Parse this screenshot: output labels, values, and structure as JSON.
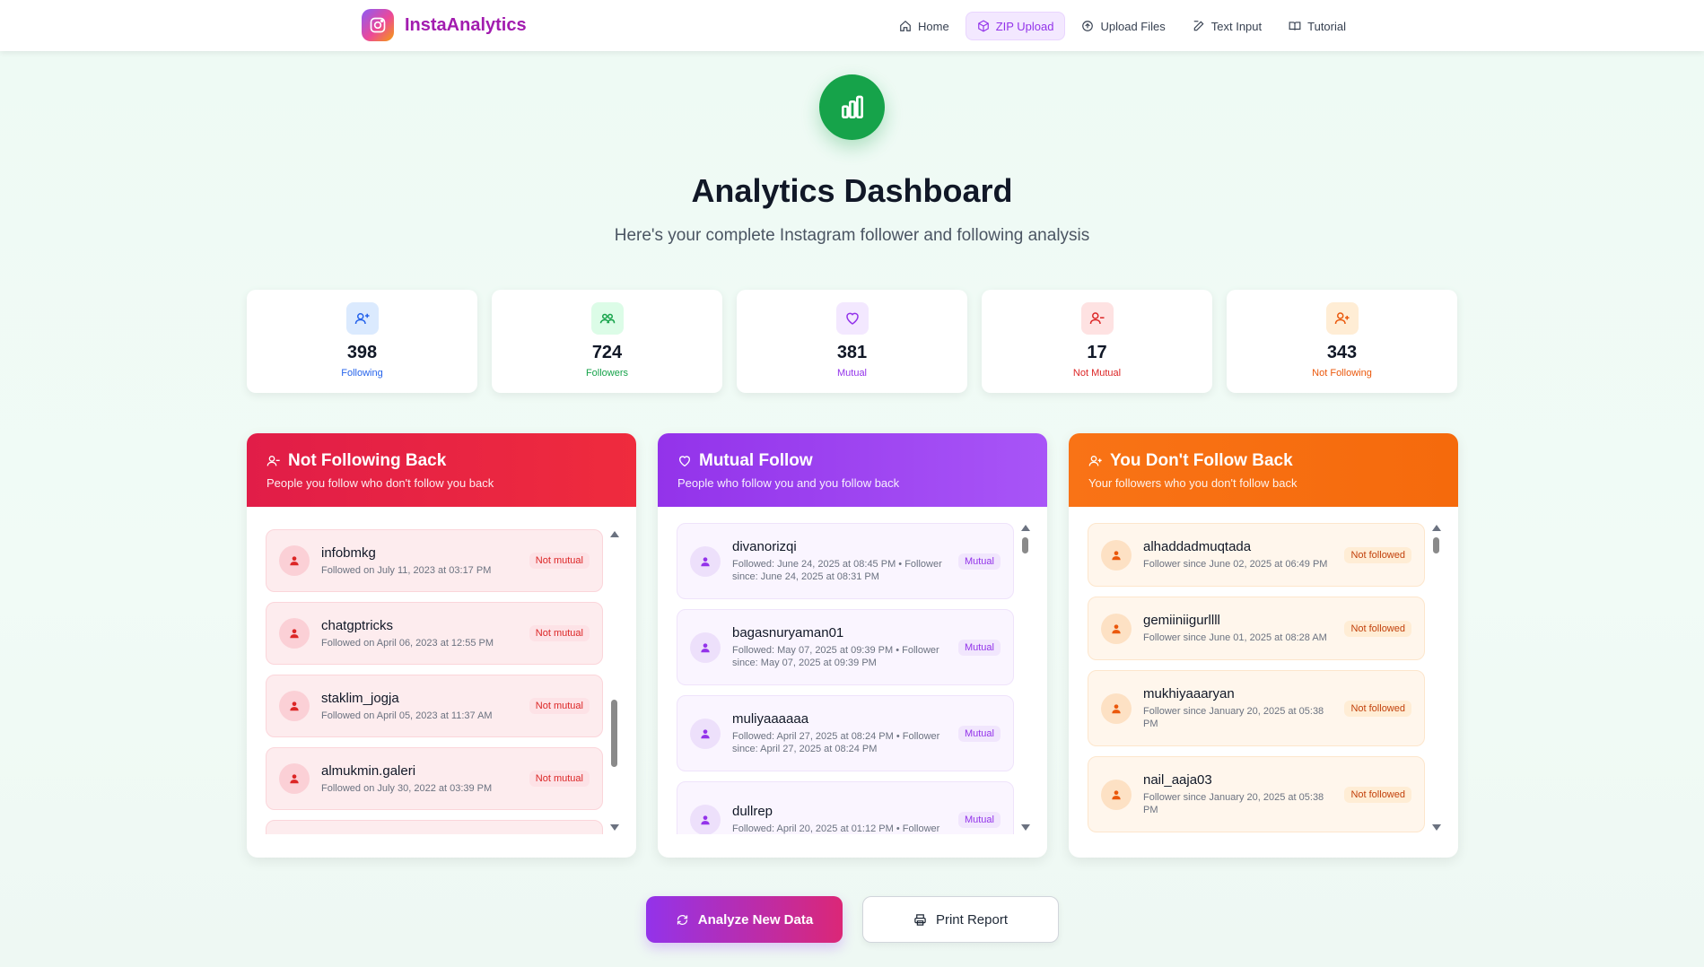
{
  "brand": {
    "name": "InstaAnalytics",
    "icon": "instagram-icon"
  },
  "nav": [
    {
      "label": "Home",
      "icon": "home-icon",
      "active": false
    },
    {
      "label": "ZIP Upload",
      "icon": "package-icon",
      "active": true
    },
    {
      "label": "Upload Files",
      "icon": "upload-icon",
      "active": false
    },
    {
      "label": "Text Input",
      "icon": "edit-icon",
      "active": false
    },
    {
      "label": "Tutorial",
      "icon": "book-icon",
      "active": false
    }
  ],
  "hero": {
    "icon": "bar-chart-icon",
    "title": "Analytics Dashboard",
    "subtitle": "Here's your complete Instagram follower and following analysis"
  },
  "stats": [
    {
      "value": "398",
      "label": "Following",
      "icon": "user-plus-icon",
      "color": "#2563eb",
      "bg": "#dbeafe"
    },
    {
      "value": "724",
      "label": "Followers",
      "icon": "users-icon",
      "color": "#16a34a",
      "bg": "#dcfce7"
    },
    {
      "value": "381",
      "label": "Mutual",
      "icon": "heart-icon",
      "color": "#9333ea",
      "bg": "#f3e8ff"
    },
    {
      "value": "17",
      "label": "Not Mutual",
      "icon": "user-minus-icon",
      "color": "#dc2626",
      "bg": "#fee2e2"
    },
    {
      "value": "343",
      "label": "Not Following",
      "icon": "user-plus-icon",
      "color": "#ea580c",
      "bg": "#ffedd5"
    }
  ],
  "panels": {
    "not_following_back": {
      "title": "Not Following Back",
      "description": "People you follow who don't follow you back",
      "color": "#e11d48",
      "items": [
        {
          "name": "infobmkg",
          "meta": "Followed on July 11, 2023 at 03:17 PM",
          "badge": "Not mutual"
        },
        {
          "name": "chatgptricks",
          "meta": "Followed on April 06, 2023 at 12:55 PM",
          "badge": "Not mutual"
        },
        {
          "name": "staklim_jogja",
          "meta": "Followed on April 05, 2023 at 11:37 AM",
          "badge": "Not mutual"
        },
        {
          "name": "almukmin.galeri",
          "meta": "Followed on July 30, 2022 at 03:39 PM",
          "badge": "Not mutual"
        }
      ]
    },
    "mutual": {
      "title": "Mutual Follow",
      "description": "People who follow you and you follow back",
      "color": "#9333ea",
      "items": [
        {
          "name": "divanorizqi",
          "meta": "Followed: June 24, 2025 at 08:45 PM • Follower since: June 24, 2025 at 08:31 PM",
          "badge": "Mutual"
        },
        {
          "name": "bagasnuryaman01",
          "meta": "Followed: May 07, 2025 at 09:39 PM • Follower since: May 07, 2025 at 09:39 PM",
          "badge": "Mutual"
        },
        {
          "name": "muliyaaaaaa",
          "meta": "Followed: April 27, 2025 at 08:24 PM • Follower since: April 27, 2025 at 08:24 PM",
          "badge": "Mutual"
        },
        {
          "name": "dullrep",
          "meta": "Followed: April 20, 2025 at 01:12 PM • Follower",
          "badge": "Mutual"
        }
      ]
    },
    "you_dont_follow_back": {
      "title": "You Don't Follow Back",
      "description": "Your followers who you don't follow back",
      "color": "#f97316",
      "items": [
        {
          "name": "alhaddadmuqtada",
          "meta": "Follower since June 02, 2025 at 06:49 PM",
          "badge": "Not followed"
        },
        {
          "name": "gemiiniigurllll",
          "meta": "Follower since June 01, 2025 at 08:28 AM",
          "badge": "Not followed"
        },
        {
          "name": "mukhiyaaaryan",
          "meta": "Follower since January 20, 2025 at 05:38 PM",
          "badge": "Not followed"
        },
        {
          "name": "nail_aaja03",
          "meta": "Follower since January 20, 2025 at 05:38 PM",
          "badge": "Not followed"
        }
      ]
    }
  },
  "actions": {
    "analyze_label": "Analyze New Data",
    "analyze_icon": "refresh-icon",
    "print_label": "Print Report",
    "print_icon": "printer-icon"
  }
}
